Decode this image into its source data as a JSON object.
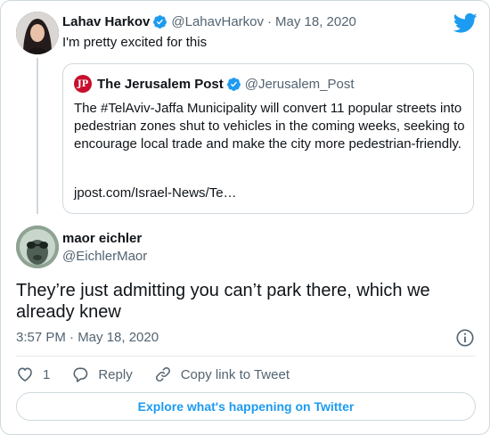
{
  "parent_tweet": {
    "display_name": "Lahav Harkov",
    "handle": "@LahavHarkov",
    "date": "May 18, 2020",
    "text": "I'm pretty excited for this",
    "avatar_icon": "profile-photo"
  },
  "quoted_tweet": {
    "logo_text": "JP",
    "display_name": "The Jerusalem Post",
    "handle": "@Jerusalem_Post",
    "body": "The #TelAviv-Jaffa Municipality will convert 11 popular streets into pedestrian zones shut to vehicles in the coming weeks, seeking to encourage local trade and make the city more pedestrian-friendly.",
    "link": "jpost.com/Israel-News/Te…",
    "brand_color": "#c8102e"
  },
  "main_tweet": {
    "display_name": "maor eichler",
    "handle": "@EichlerMaor",
    "text": "They’re just admitting you can’t park there, which we already knew",
    "timestamp": "3:57 PM · May 18, 2020"
  },
  "actions": {
    "like_count": "1",
    "reply_label": "Reply",
    "copy_label": "Copy link to Tweet"
  },
  "explore_label": "Explore what's happening on Twitter",
  "colors": {
    "accent": "#1d9bf0",
    "muted": "#536471",
    "border": "#cfd9de"
  },
  "separator": "·"
}
